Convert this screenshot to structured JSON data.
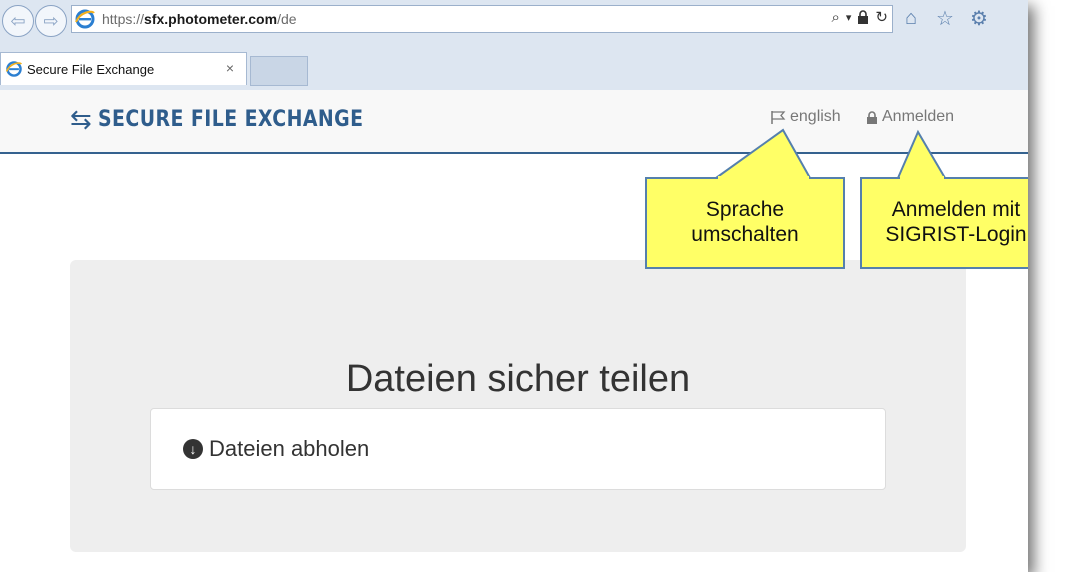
{
  "browser": {
    "url_protocol": "https://",
    "url_host": "sfx.photometer.com",
    "url_path": "/de",
    "tab_title": "Secure File Exchange",
    "tab_close": "×"
  },
  "site": {
    "brand": "SECURE FILE EXCHANGE",
    "brand_icon": "⇆",
    "lang_label": "english",
    "login_label": "Anmelden"
  },
  "hero": {
    "title": "Dateien sicher teilen",
    "fetch_label": "Dateien abholen"
  },
  "callouts": {
    "language": [
      "Sprache",
      "umschalten"
    ],
    "login": [
      "Anmelden mit",
      "SIGRIST-Login"
    ]
  },
  "colors": {
    "brand": "#2f5d8c",
    "callout_fill": "#ffff66",
    "callout_border": "#5580ad"
  }
}
